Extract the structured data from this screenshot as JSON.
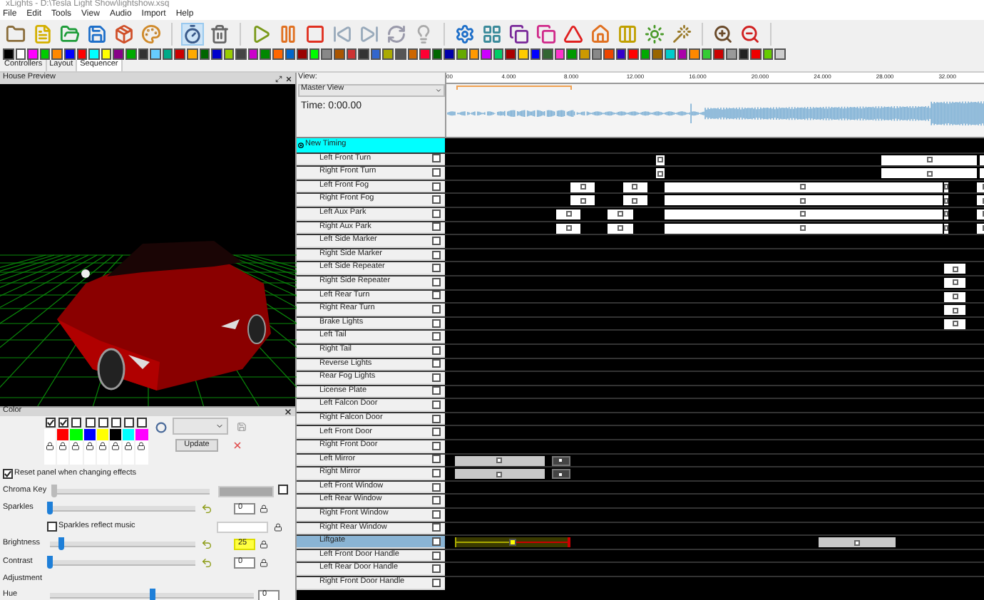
{
  "window": {
    "title": "xLights - D:\\Tesla Light Show\\lightshow.xsq"
  },
  "menu": [
    "File",
    "Edit",
    "Tools",
    "View",
    "Audio",
    "Import",
    "Help"
  ],
  "tabs": [
    {
      "label": "Controllers",
      "selected": false
    },
    {
      "label": "Layout",
      "selected": false
    },
    {
      "label": "Sequencer",
      "selected": true
    }
  ],
  "house_preview": {
    "title": "House Preview"
  },
  "color_panel": {
    "title": "Color",
    "palette": [
      {
        "color": "#ffffff",
        "checked": true
      },
      {
        "color": "#ff0000",
        "checked": true
      },
      {
        "color": "#00ff00",
        "checked": false
      },
      {
        "color": "#0000ff",
        "checked": false
      },
      {
        "color": "#ffff00",
        "checked": false
      },
      {
        "color": "#000000",
        "checked": false
      },
      {
        "color": "#00ffff",
        "checked": false
      },
      {
        "color": "#ff00ff",
        "checked": false
      }
    ],
    "update_button": "Update",
    "reset_option": {
      "label": "Reset panel when changing effects",
      "checked": true
    },
    "controls": [
      {
        "kind": "chroma",
        "label": "Chroma Key",
        "level": 0.02,
        "disabled": true,
        "checked": false
      },
      {
        "kind": "slider",
        "label": "Sparkles",
        "level": 0,
        "value": "0",
        "highlighted": false
      },
      {
        "kind": "checkbox",
        "label": "Sparkles reflect music",
        "checked": false
      },
      {
        "kind": "slider",
        "label": "Brightness",
        "level": 0.08,
        "value": "25",
        "highlighted": true
      },
      {
        "kind": "slider",
        "label": "Contrast",
        "level": 0,
        "value": "0",
        "highlighted": false
      },
      {
        "kind": "heading",
        "label": "Adjustment"
      },
      {
        "kind": "slider",
        "label": "Hue",
        "level": 0.5,
        "value": "0",
        "highlighted": false
      }
    ]
  },
  "view": {
    "label": "View:",
    "selected_view": "Master View",
    "time": "Time: 0:00.00",
    "ruler": [
      "00",
      "4.000",
      "8.000",
      "12.000",
      "16.000",
      "20.000",
      "24.000",
      "28.000",
      "32.000"
    ]
  },
  "timing_track": {
    "label": "New Timing"
  },
  "models": [
    {
      "name": "Left Front Turn",
      "selected": false,
      "effects": [
        {
          "kind": "normal"
        },
        {
          "kind": "normal"
        },
        {
          "kind": "normal"
        }
      ]
    },
    {
      "name": "Right Front Turn",
      "selected": false,
      "effects": [
        {
          "kind": "normal"
        },
        {
          "kind": "normal"
        },
        {
          "kind": "normal"
        }
      ]
    },
    {
      "name": "Left Front Fog",
      "selected": false,
      "effects": [
        {
          "kind": "normal"
        },
        {
          "kind": "normal"
        },
        {
          "kind": "normal"
        },
        {
          "kind": "normal"
        },
        {
          "kind": "normal"
        }
      ]
    },
    {
      "name": "Right Front Fog",
      "selected": false,
      "effects": [
        {
          "kind": "normal"
        },
        {
          "kind": "normal"
        },
        {
          "kind": "normal"
        },
        {
          "kind": "normal"
        },
        {
          "kind": "normal"
        }
      ]
    },
    {
      "name": "Left Aux Park",
      "selected": false,
      "effects": [
        {
          "kind": "normal"
        },
        {
          "kind": "normal"
        },
        {
          "kind": "normal"
        },
        {
          "kind": "normal"
        },
        {
          "kind": "normal"
        }
      ]
    },
    {
      "name": "Right Aux Park",
      "selected": false,
      "effects": [
        {
          "kind": "normal"
        },
        {
          "kind": "normal"
        },
        {
          "kind": "normal"
        },
        {
          "kind": "normal"
        },
        {
          "kind": "normal"
        }
      ]
    },
    {
      "name": "Left Side Marker",
      "selected": false
    },
    {
      "name": "Right Side Marker",
      "selected": false
    },
    {
      "name": "Left Side Repeater",
      "selected": false,
      "effects": [
        {
          "kind": "normal"
        }
      ]
    },
    {
      "name": "Right Side Repeater",
      "selected": false,
      "effects": [
        {
          "kind": "normal"
        }
      ]
    },
    {
      "name": "Left Rear Turn",
      "selected": false,
      "effects": [
        {
          "kind": "normal"
        }
      ]
    },
    {
      "name": "Right Rear Turn",
      "selected": false,
      "effects": [
        {
          "kind": "normal"
        }
      ]
    },
    {
      "name": "Brake Lights",
      "selected": false,
      "effects": [
        {
          "kind": "normal"
        }
      ]
    },
    {
      "name": "Left Tail",
      "selected": false
    },
    {
      "name": "Right Tail",
      "selected": false
    },
    {
      "name": "Reverse Lights",
      "selected": false
    },
    {
      "name": "Rear Fog Lights",
      "selected": false
    },
    {
      "name": "License Plate",
      "selected": false
    },
    {
      "name": "Left Falcon Door",
      "selected": false
    },
    {
      "name": "Right Falcon Door",
      "selected": false
    },
    {
      "name": "Left Front Door",
      "selected": false
    },
    {
      "name": "Right Front Door",
      "selected": false
    },
    {
      "name": "Left Mirror",
      "selected": false,
      "effects": [
        {
          "kind": "grey"
        },
        {
          "kind": "dark"
        }
      ]
    },
    {
      "name": "Right Mirror",
      "selected": false,
      "effects": [
        {
          "kind": "grey"
        },
        {
          "kind": "dark"
        }
      ]
    },
    {
      "name": "Left Front Window",
      "selected": false
    },
    {
      "name": "Left Rear Window",
      "selected": false
    },
    {
      "name": "Right Front Window",
      "selected": false
    },
    {
      "name": "Right Rear Window",
      "selected": false
    },
    {
      "name": "Liftgate",
      "selected": true,
      "effects": [
        {
          "kind": "active"
        },
        {
          "kind": "grey"
        }
      ]
    },
    {
      "name": "Left Front Door Handle",
      "selected": false
    },
    {
      "name": "Left Rear Door Handle",
      "selected": false
    },
    {
      "name": "Right Front Door Handle",
      "selected": false
    }
  ]
}
